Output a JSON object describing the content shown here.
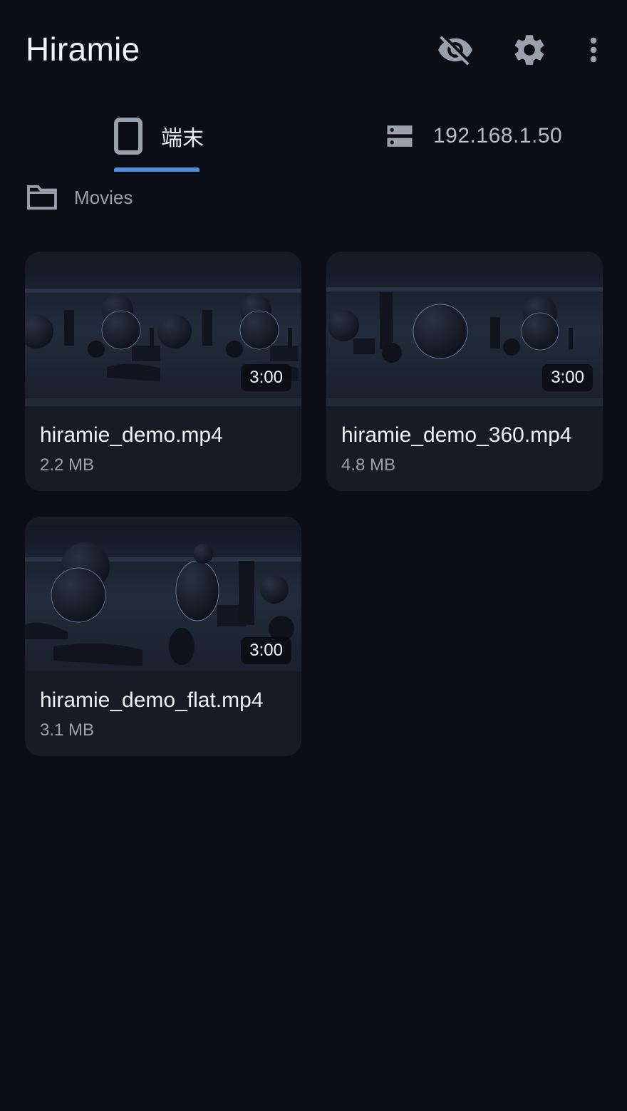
{
  "app": {
    "title": "Hiramie"
  },
  "toolbar": {
    "icons": [
      "eye-off-icon",
      "gear-icon",
      "more-vert-icon"
    ]
  },
  "tabs": [
    {
      "label": "端末",
      "icon": "phone-icon",
      "selected": true
    },
    {
      "label": "192.168.1.50",
      "icon": "server-icon",
      "selected": false
    }
  ],
  "breadcrumb": {
    "label": "Movies",
    "icon": "folder-icon"
  },
  "videos": [
    {
      "name": "hiramie_demo.mp4",
      "size": "2.2 MB",
      "duration": "3:00",
      "variant": "side-by-side"
    },
    {
      "name": "hiramie_demo_360.mp4",
      "size": "4.8 MB",
      "duration": "3:00",
      "variant": "360"
    },
    {
      "name": "hiramie_demo_flat.mp4",
      "size": "3.1 MB",
      "duration": "3:00",
      "variant": "flat"
    }
  ],
  "colors": {
    "background": "#0b0e16",
    "card": "#161b26",
    "accent": "#4a8fe0",
    "icon": "#9aa1ad"
  }
}
